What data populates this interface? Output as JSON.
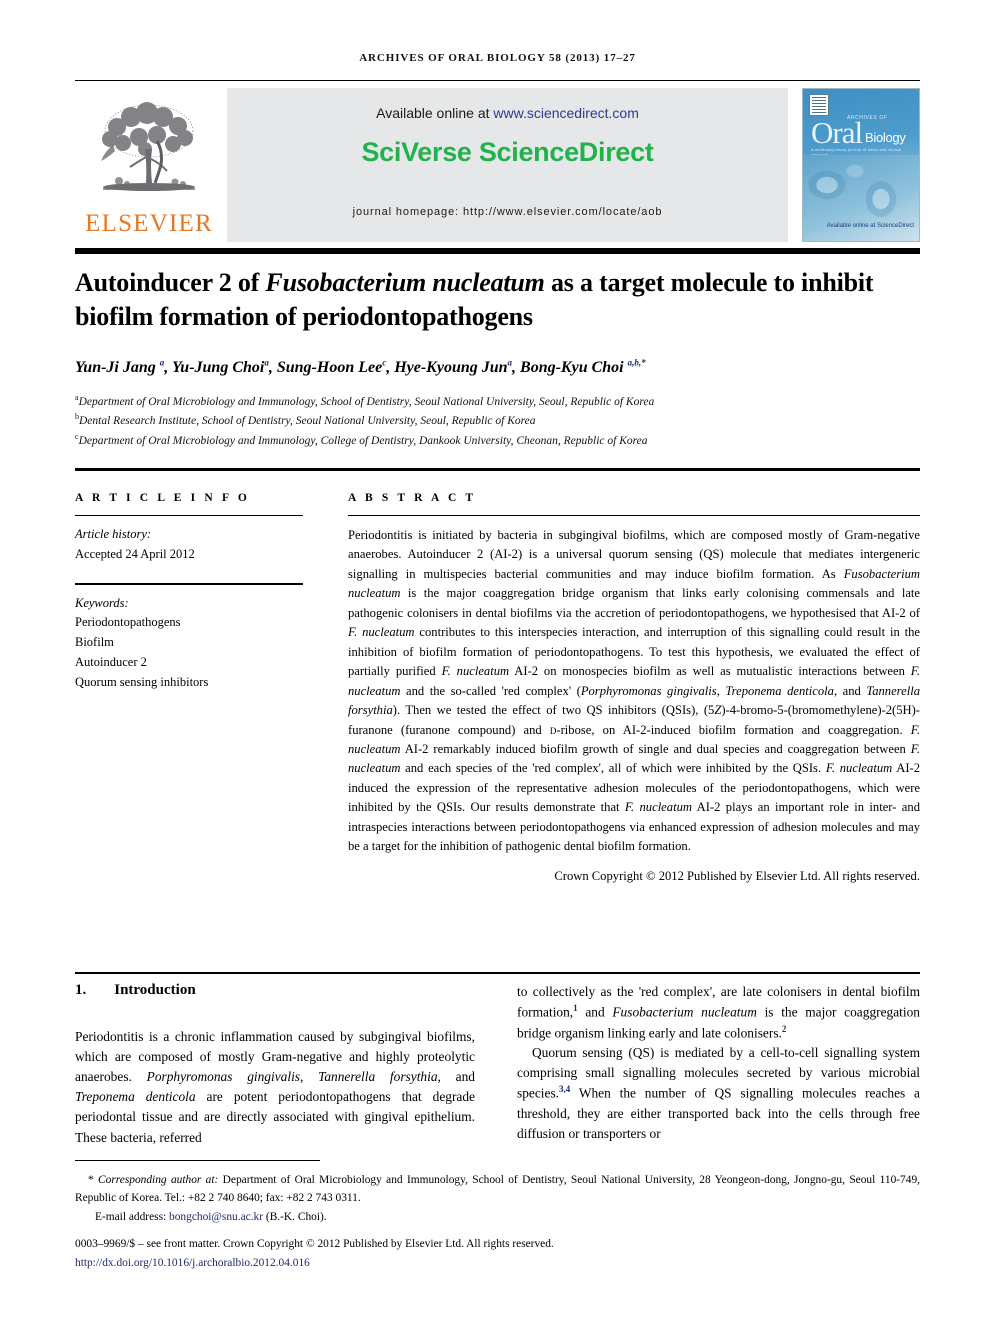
{
  "running_head": "ARCHIVES OF ORAL BIOLOGY 58 (2013) 17–27",
  "masthead": {
    "publisher_logo_text": "ELSEVIER",
    "available_prefix": "Available online at ",
    "available_url": "www.sciencedirect.com",
    "platform_name": "SciVerse ScienceDirect",
    "journal_homepage": "journal homepage: http://www.elsevier.com/locate/aob",
    "cover": {
      "archives_label": "ARCHIVES OF",
      "oral_label": "Oral",
      "biology_label": "Biology",
      "tagline": "A multidisciplinary journal of basic and clinical research",
      "sciencedirect_label": "Available online at ScienceDirect",
      "sciencedirect_url": "www.sciencedirect.com"
    }
  },
  "article": {
    "title_part1": "Autoinducer 2 of ",
    "title_italic": "Fusobacterium nucleatum",
    "title_part2": " as a target molecule to inhibit biofilm formation of periodontopathogens",
    "authors": "Yun-Ji Jang a, Yu-Jung Choi a, Sung-Hoon Lee c, Hye-Kyoung Jun a, Bong-Kyu Choi a,b,*",
    "affiliations": [
      {
        "mark": "a",
        "text": "Department of Oral Microbiology and Immunology, School of Dentistry, Seoul National University, Seoul, Republic of Korea"
      },
      {
        "mark": "b",
        "text": "Dental Research Institute, School of Dentistry, Seoul National University, Seoul, Republic of Korea"
      },
      {
        "mark": "c",
        "text": "Department of Oral Microbiology and Immunology, College of Dentistry, Dankook University, Cheonan, Republic of Korea"
      }
    ]
  },
  "article_info": {
    "heading": "A R T I C L E   I N F O",
    "history_label": "Article history:",
    "history_value": "Accepted 24 April 2012",
    "keywords_label": "Keywords:",
    "keywords": [
      "Periodontopathogens",
      "Biofilm",
      "Autoinducer 2",
      "Quorum sensing inhibitors"
    ]
  },
  "abstract": {
    "heading": "A B S T R A C T",
    "body": "Periodontitis is initiated by bacteria in subgingival biofilms, which are composed mostly of Gram-negative anaerobes. Autoinducer 2 (AI-2) is a universal quorum sensing (QS) molecule that mediates intergeneric signalling in multispecies bacterial communities and may induce biofilm formation. As Fusobacterium nucleatum is the major coaggregation bridge organism that links early colonising commensals and late pathogenic colonisers in dental biofilms via the accretion of periodontopathogens, we hypothesised that AI-2 of F. nucleatum contributes to this interspecies interaction, and interruption of this signalling could result in the inhibition of biofilm formation of periodontopathogens. To test this hypothesis, we evaluated the effect of partially purified F. nucleatum AI-2 on monospecies biofilm as well as mutualistic interactions between F. nucleatum and the so-called 'red complex' (Porphyromonas gingivalis, Treponema denticola, and Tannerella forsythia). Then we tested the effect of two QS inhibitors (QSIs), (5Z)-4-bromo-5-(bromomethylene)-2(5H)-furanone (furanone compound) and D-ribose, on AI-2-induced biofilm formation and coaggregation. F. nucleatum AI-2 remarkably induced biofilm growth of single and dual species and coaggregation between F. nucleatum and each species of the 'red complex', all of which were inhibited by the QSIs. F. nucleatum AI-2 induced the expression of the representative adhesion molecules of the periodontopathogens, which were inhibited by the QSIs. Our results demonstrate that F. nucleatum AI-2 plays an important role in inter- and intraspecies interactions between periodontopathogens via enhanced expression of adhesion molecules and may be a target for the inhibition of pathogenic dental biofilm formation.",
    "copyright": "Crown Copyright © 2012 Published by Elsevier Ltd. All rights reserved."
  },
  "introduction": {
    "number": "1.",
    "heading": "Introduction",
    "left_paragraph": "Periodontitis is a chronic inflammation caused by subgingival biofilms, which are composed of mostly Gram-negative and highly proteolytic anaerobes. Porphyromonas gingivalis, Tannerella forsythia, and Treponema denticola are potent periodontopathogens that degrade periodontal tissue and are directly associated with gingival epithelium. These bacteria, referred",
    "right_paragraph_1": "to collectively as the 'red complex', are late colonisers in dental biofilm formation,1 and Fusobacterium nucleatum is the major coaggregation bridge organism linking early and late colonisers.2",
    "right_paragraph_2": "Quorum sensing (QS) is mediated by a cell-to-cell signalling system comprising small signalling molecules secreted by various microbial species.3,4 When the number of QS signalling molecules reaches a threshold, they are either transported back into the cells through free diffusion or transporters or"
  },
  "footer": {
    "corresponding_label": "Corresponding author at:",
    "corresponding_text": " Department of Oral Microbiology and Immunology, School of Dentistry, Seoul National University, 28 Yeongeon-dong, Jongno-gu, Seoul 110-749, Republic of Korea. Tel.: +82 2 740 8640; fax: +82 2 743 0311.",
    "email_label": "E-mail address: ",
    "email_address": "bongchoi@snu.ac.kr",
    "email_suffix": " (B.-K. Choi).",
    "front_matter": "0003–9969/$ – see front matter. Crown Copyright © 2012 Published by Elsevier Ltd. All rights reserved.",
    "doi": "http://dx.doi.org/10.1016/j.archoralbio.2012.04.016"
  },
  "colors": {
    "elsevier_orange": "#E87722",
    "sciverse_green": "#21b24b",
    "link_blue": "#1b2a6b",
    "banner_grey": "#e6e7e8",
    "cover_blue": "#4e9ccd"
  }
}
